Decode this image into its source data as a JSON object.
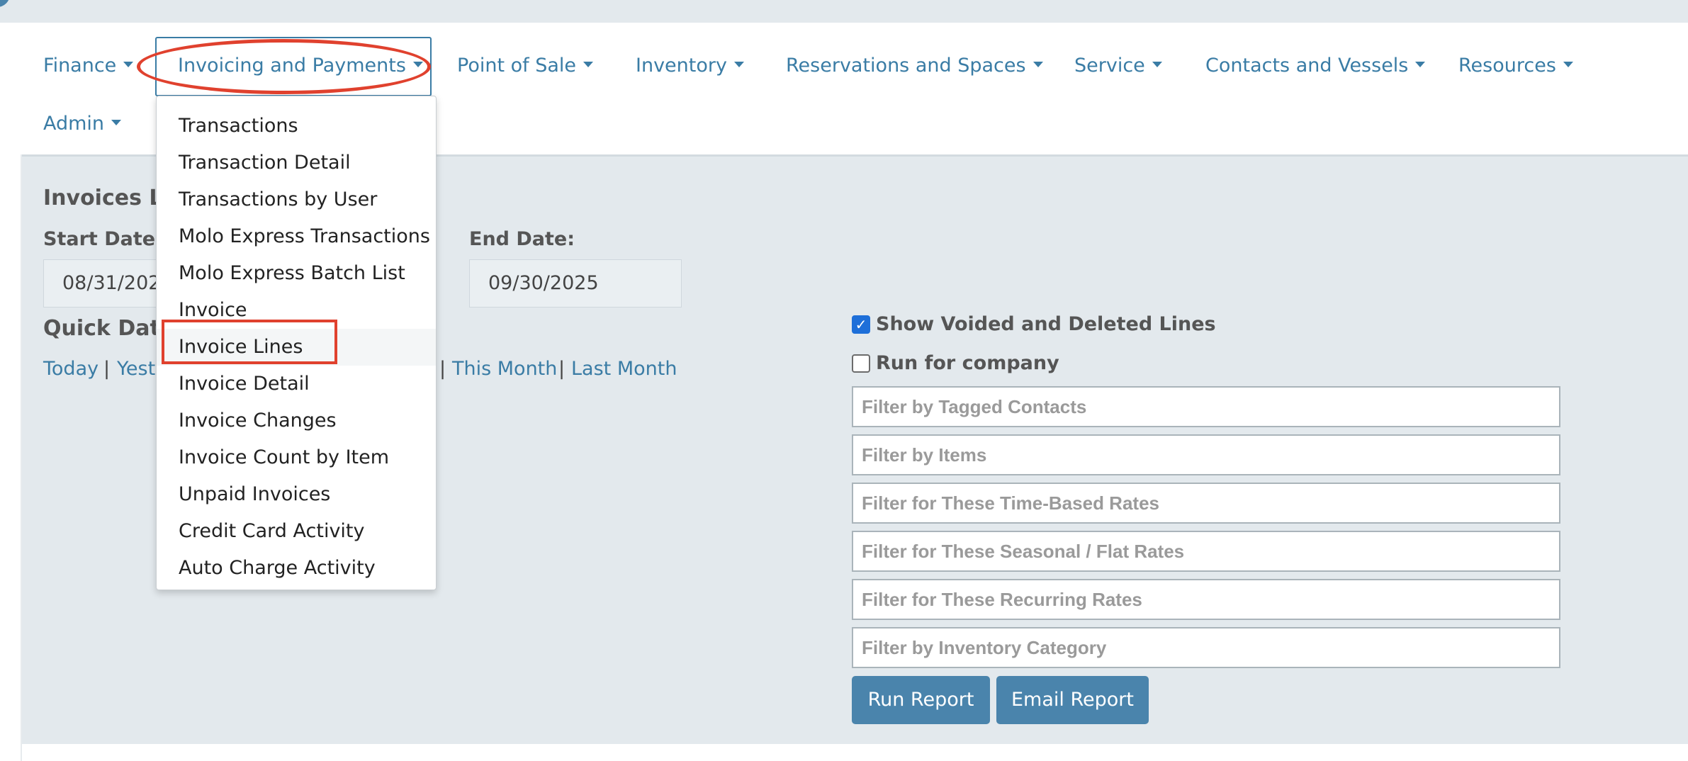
{
  "nav": {
    "items": [
      {
        "label": "Finance"
      },
      {
        "label": "Invoicing and Payments"
      },
      {
        "label": "Point of Sale"
      },
      {
        "label": "Inventory"
      },
      {
        "label": "Reservations and Spaces"
      },
      {
        "label": "Service"
      },
      {
        "label": "Contacts and Vessels"
      },
      {
        "label": "Resources"
      },
      {
        "label": "Admin"
      }
    ],
    "active": "Invoicing and Payments"
  },
  "dropdown": {
    "items": [
      {
        "label": "Transactions"
      },
      {
        "label": "Transaction Detail"
      },
      {
        "label": "Transactions by User"
      },
      {
        "label": "Molo Express Transactions"
      },
      {
        "label": "Molo Express Batch List"
      },
      {
        "label": "Invoice"
      },
      {
        "label": "Invoice Lines"
      },
      {
        "label": "Invoice Detail"
      },
      {
        "label": "Invoice Changes"
      },
      {
        "label": "Invoice Count by Item"
      },
      {
        "label": "Unpaid Invoices"
      },
      {
        "label": "Credit Card Activity"
      },
      {
        "label": "Auto Charge Activity"
      }
    ],
    "highlighted": "Invoice Lines"
  },
  "report": {
    "title_partial": "Invoices Li",
    "start_label": "Start Date:",
    "start_value_partial": "08/31/202",
    "end_label": "End Date:",
    "end_value": "09/30/2025",
    "quick_label_partial": "Quick Date",
    "quick_links": {
      "today": "Today",
      "yesterday_partial": "Yest",
      "this_month": "This Month",
      "last_month": "Last Month"
    },
    "separator": "|"
  },
  "options": {
    "show_voided": {
      "label": "Show Voided and Deleted Lines",
      "checked": true
    },
    "run_company": {
      "label": "Run for company",
      "checked": false
    }
  },
  "filters": [
    {
      "placeholder": "Filter by Tagged Contacts"
    },
    {
      "placeholder": "Filter by Items"
    },
    {
      "placeholder": "Filter for These Time-Based Rates"
    },
    {
      "placeholder": "Filter for These Seasonal / Flat Rates"
    },
    {
      "placeholder": "Filter for These Recurring Rates"
    },
    {
      "placeholder": "Filter by Inventory Category"
    }
  ],
  "buttons": {
    "run": "Run Report",
    "email": "Email Report"
  },
  "colors": {
    "link": "#3a7ca5",
    "panel": "#e3e9ed",
    "button": "#4a84ac",
    "annotation": "#e0412e",
    "checkbox": "#1e6fd9"
  }
}
